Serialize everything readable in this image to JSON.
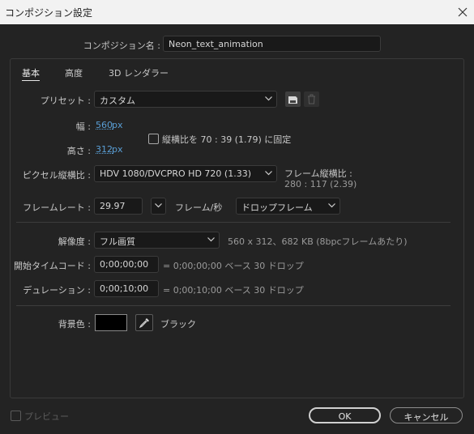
{
  "window": {
    "title": "コンポジション設定"
  },
  "comp_name": {
    "label": "コンポジション名 :",
    "value": "Neon_text_animation"
  },
  "tabs": [
    {
      "label": "基本",
      "active": true
    },
    {
      "label": "高度",
      "active": false
    },
    {
      "label": "3D レンダラー",
      "active": false
    }
  ],
  "preset": {
    "label": "プリセット :",
    "value": "カスタム"
  },
  "width": {
    "label": "幅 :",
    "value": "560",
    "unit": "px"
  },
  "height": {
    "label": "高さ :",
    "value": "312",
    "unit": "px"
  },
  "aspect_lock": {
    "label": "縦横比を 70 : 39 (1.79) に固定",
    "checked": false
  },
  "pixel_aspect": {
    "label": "ピクセル縦横比 :",
    "value": "HDV 1080/DVCPRO HD 720 (1.33)"
  },
  "frame_aspect": {
    "label": "フレーム縦横比 :",
    "value": "280 : 117 (2.39)"
  },
  "frame_rate": {
    "label": "フレームレート :",
    "value": "29.97",
    "unit": "フレーム/秒",
    "drop_mode": "ドロップフレーム"
  },
  "resolution": {
    "label": "解像度 :",
    "value": "フル画質",
    "info": "560 x 312、682 KB (8bpcフレームあたり)"
  },
  "start_timecode": {
    "label": "開始タイムコード :",
    "value": "0;00;00;00",
    "info": "= 0;00;00;00  ベース 30  ドロップ"
  },
  "duration": {
    "label": "デュレーション :",
    "value": "0;00;10;00",
    "info": "= 0;00;10;00  ベース 30  ドロップ"
  },
  "background": {
    "label": "背景色 :",
    "color_name": "ブラック",
    "color": "#000000"
  },
  "footer": {
    "preview_label": "プレビュー",
    "ok_label": "OK",
    "cancel_label": "キャンセル"
  },
  "colors": {
    "accent_value": "#5a9fd6",
    "background": "#232323",
    "titlebar": "#f2f2f2"
  }
}
